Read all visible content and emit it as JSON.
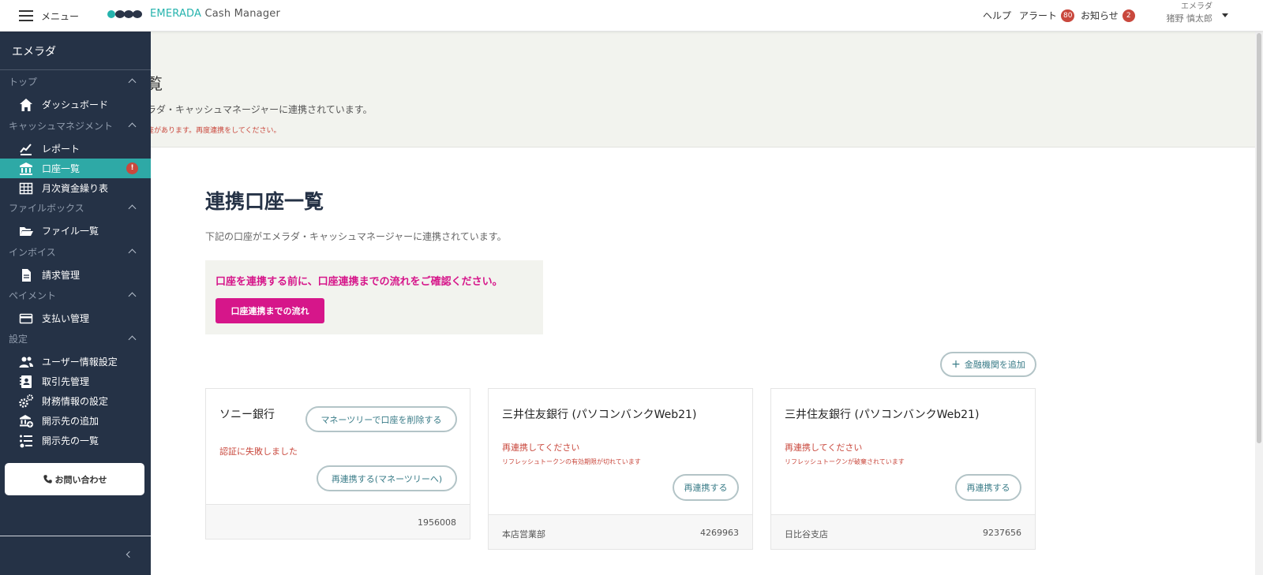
{
  "topbar": {
    "menu_label": "メニュー",
    "brand_prefix": "EMERADA",
    "brand_suffix": " Cash Manager",
    "help": "ヘルプ",
    "alert": "アラート",
    "alert_count": "80",
    "news": "お知らせ",
    "news_count": "2",
    "user_org": "エメラダ",
    "user_name": "猪野 慎太郎"
  },
  "sidebar": {
    "org": "エメラダ",
    "sections": {
      "top": "トップ",
      "cash": "キャッシュマネジメント",
      "filebox": "ファイルボックス",
      "invoice": "インボイス",
      "payment": "ペイメント",
      "settings": "設定"
    },
    "items": {
      "dashboard": "ダッシュボード",
      "report": "レポート",
      "accounts": "口座一覧",
      "accounts_alert": "!",
      "monthly": "月次資金繰り表",
      "files": "ファイル一覧",
      "billing": "請求管理",
      "payments": "支払い管理",
      "user_settings": "ユーザー情報設定",
      "partners": "取引先管理",
      "finance_settings": "財務情報の設定",
      "disclosure_add": "開示先の追加",
      "disclosure_list": "開示先の一覧"
    },
    "contact": "お問い合わせ"
  },
  "banner": {
    "title": "覧",
    "desc": "ラダ・キャッシュマネージャーに連携されています。",
    "warning": "座があります。再度連携をしてください。"
  },
  "main": {
    "title": "連携口座一覧",
    "description": "下記の口座がエメラダ・キャッシュマネージャーに連携されています。",
    "notice_text": "口座を連携する前に、口座連携までの流れをご確認ください。",
    "notice_button": "口座連携までの流れ",
    "add_button": "金融機関を追加"
  },
  "cards": [
    {
      "bank": "ソニー銀行",
      "delete_button": "マネーツリーで口座を削除する",
      "error": "認証に失敗しました",
      "reconnect_button": "再連携する(マネーツリーへ)",
      "branch": "",
      "account": "1956008"
    },
    {
      "bank": "三井住友銀行 (パソコンバンクWeb21)",
      "error": "再連携してください",
      "sub_error": "リフレッシュトークンの有効期限が切れています",
      "reconnect_button": "再連携する",
      "branch": "本店営業部",
      "account": "4269963"
    },
    {
      "bank": "三井住友銀行 (パソコンバンクWeb21)",
      "error": "再連携してください",
      "sub_error": "リフレッシュトークンが破棄されています",
      "reconnect_button": "再連携する",
      "branch": "日比谷支店",
      "account": "9237656"
    }
  ],
  "colors": {
    "sidebar_bg": "#253246",
    "accent_teal": "#2ea9a6",
    "brand_teal": "#25b3ad",
    "magenta": "#d6168a",
    "error_red": "#c9483d"
  }
}
